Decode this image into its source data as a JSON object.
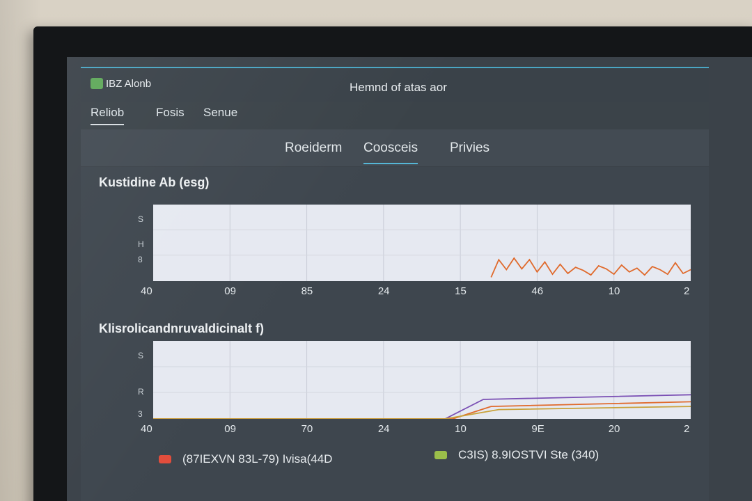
{
  "app": {
    "name": "IBZ Alonb",
    "window_title": "Hemnd of atas aor"
  },
  "menu": {
    "items": [
      "Reliob",
      "Fosis",
      "Senue"
    ]
  },
  "tabs": {
    "items": [
      "Roeiderm",
      "Coosceis",
      "Privies"
    ],
    "active": 1
  },
  "colors": {
    "accent": "#55b6d6",
    "orange": "#e06a2c",
    "purple": "#7a4fb4",
    "gold": "#c9a23a"
  },
  "chart_data": [
    {
      "type": "line",
      "title": "Kustidine Ab (esg)",
      "x_ticks": [
        "40",
        "09",
        "85",
        "24",
        "15",
        "46",
        "10",
        "2"
      ],
      "y_ticks": [
        "8",
        "H",
        "S"
      ],
      "ylim": [
        0,
        10
      ],
      "series": [
        {
          "color": "#e06a2c",
          "x": [
            4.4,
            4.5,
            4.6,
            4.7,
            4.8,
            4.9,
            5.0,
            5.1,
            5.2,
            5.3,
            5.4,
            5.5,
            5.6,
            5.7,
            5.8,
            5.9,
            6.0,
            6.1,
            6.2,
            6.3,
            6.4,
            6.5,
            6.6,
            6.7,
            6.8,
            6.9,
            7.0
          ],
          "y": [
            0.5,
            2.8,
            1.5,
            3.0,
            1.6,
            2.8,
            1.2,
            2.5,
            0.9,
            2.2,
            1.0,
            1.8,
            1.4,
            0.8,
            2.0,
            1.6,
            0.9,
            2.1,
            1.2,
            1.7,
            0.8,
            1.9,
            1.5,
            0.9,
            2.4,
            1.0,
            1.5
          ]
        }
      ]
    },
    {
      "type": "line",
      "title": "Klisrolicandnruvaldicinalt f)",
      "x_ticks": [
        "40",
        "09",
        "70",
        "24",
        "10",
        "9E",
        "20",
        "2"
      ],
      "y_ticks": [
        "3",
        "R",
        "S"
      ],
      "ylim": [
        0,
        10
      ],
      "series": [
        {
          "name": "(87IEXVN 83L-79) Ivisa(44D",
          "color": "#7a4fb4",
          "x": [
            0,
            3.8,
            4.3,
            7.0
          ],
          "y": [
            0,
            0,
            2.5,
            3.1
          ]
        },
        {
          "name": "C3IS) 8.9IOSTVI Ste (340)",
          "color": "#e06a2c",
          "x": [
            0,
            3.9,
            4.4,
            7.0
          ],
          "y": [
            0,
            0,
            1.6,
            2.2
          ]
        },
        {
          "color": "#c9a23a",
          "x": [
            0,
            3.8,
            4.5,
            7.0
          ],
          "y": [
            0,
            0,
            1.2,
            1.6
          ]
        }
      ]
    }
  ],
  "legend": {
    "items": [
      "(87IEXVN 83L-79) Ivisa(44D",
      "C3IS) 8.9IOSTVI Ste (340)"
    ],
    "colors": [
      "#e24d3c",
      "#9bbf4a"
    ]
  }
}
